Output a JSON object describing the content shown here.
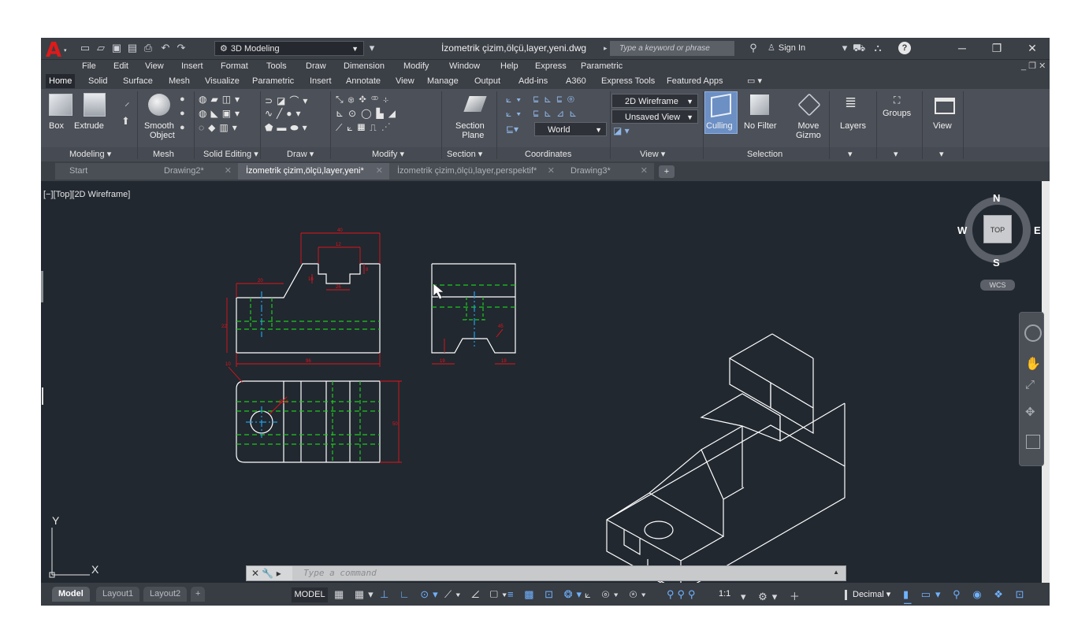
{
  "titlebar": {
    "workspace": "3D Modeling",
    "document_title": "İzometrik çizim,ölçü,layer,yeni.dwg",
    "search_placeholder": "Type a keyword or phrase",
    "sign_in": "Sign In",
    "help_icon": "?"
  },
  "menubar": [
    "File",
    "Edit",
    "View",
    "Insert",
    "Format",
    "Tools",
    "Draw",
    "Dimension",
    "Modify",
    "Window",
    "Help",
    "Express",
    "Parametric"
  ],
  "ribbon_tabs": [
    "Home",
    "Solid",
    "Surface",
    "Mesh",
    "Visualize",
    "Parametric",
    "Insert",
    "Annotate",
    "View",
    "Manage",
    "Output",
    "Add-ins",
    "A360",
    "Express Tools",
    "Featured Apps"
  ],
  "ribbon_active_tab": "Home",
  "ribbon": {
    "box": "Box",
    "extrude": "Extrude",
    "smooth_object_1": "Smooth",
    "smooth_object_2": "Object",
    "section_plane_1": "Section",
    "section_plane_2": "Plane",
    "visual_style": "2D Wireframe",
    "saved_view": "Unsaved View",
    "ucs": "World",
    "culling": "Culling",
    "no_filter": "No Filter",
    "move_gizmo_1": "Move",
    "move_gizmo_2": "Gizmo",
    "layers": "Layers",
    "groups": "Groups",
    "view": "View"
  },
  "ribbon_panels": [
    "Modeling ▾",
    "Mesh",
    "Solid Editing ▾",
    "Draw ▾",
    "Modify ▾",
    "Section ▾",
    "Coordinates",
    "View ▾",
    "Selection"
  ],
  "file_tabs": [
    {
      "label": "Start",
      "active": false
    },
    {
      "label": "Drawing2*",
      "active": false
    },
    {
      "label": "İzometrik çizim,ölçü,layer,yeni*",
      "active": true
    },
    {
      "label": "İzometrik çizim,ölçü,layer,perspektif*",
      "active": false
    },
    {
      "label": "Drawing3*",
      "active": false
    }
  ],
  "viewport_label": "[−][Top][2D Wireframe]",
  "viewcube": {
    "top": "TOP",
    "n": "N",
    "s": "S",
    "e": "E",
    "w": "W",
    "wcs": "WCS"
  },
  "ucs_icon": {
    "x": "X",
    "y": "Y"
  },
  "command_line": {
    "placeholder": "Type a command"
  },
  "layout_tabs": [
    "Model",
    "Layout1",
    "Layout2"
  ],
  "status": {
    "model": "MODEL",
    "scale": "1:1",
    "units": "Decimal"
  },
  "dimensions": {
    "top_width": "40",
    "slot_width": "12",
    "left_step": "20",
    "slot_depth": "16",
    "slot_bottom": "26",
    "slot_right": "8",
    "left_height": "22",
    "overall_length": "96",
    "side_angle": "45",
    "side_left": "19",
    "side_right": "19",
    "top_radius": "10",
    "circle": "Ø14",
    "plan_height": "50"
  },
  "colors": {
    "viewport_bg": "#212830",
    "drawing_lines": "#ffffff",
    "dimensions": "#e3141a",
    "hidden_lines": "#1ec81e",
    "centerlines": "#1ea0e6"
  }
}
